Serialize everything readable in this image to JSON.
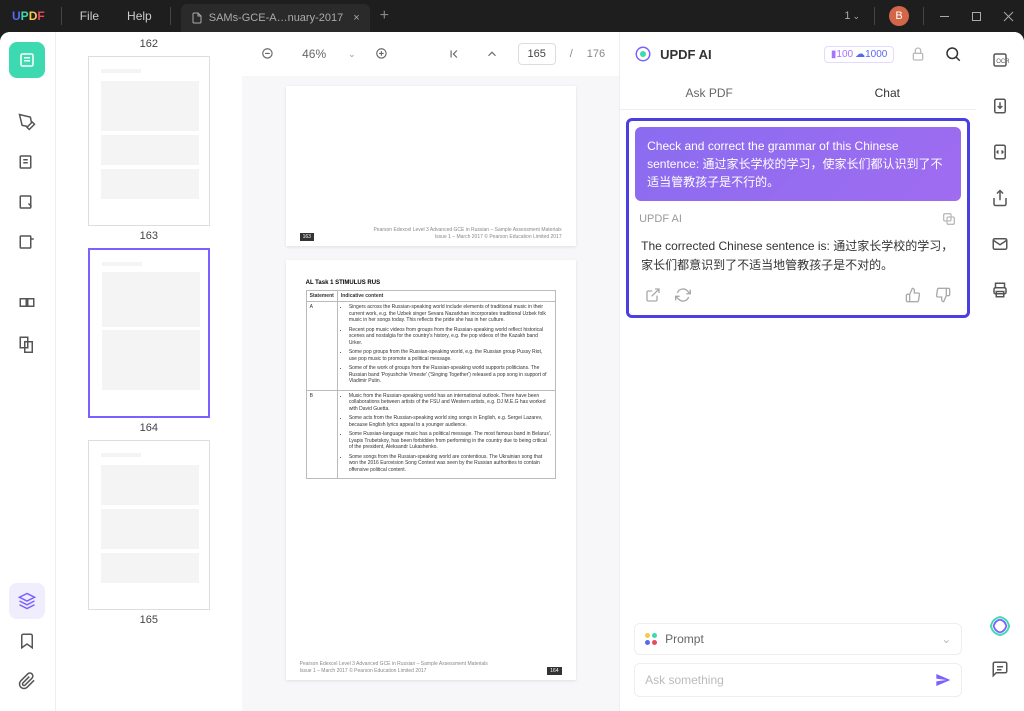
{
  "titlebar": {
    "menus": [
      "File",
      "Help"
    ],
    "tab_title": "SAMs-GCE-A…nuary-2017",
    "layout_label": "1",
    "avatar_initial": "B"
  },
  "thumbs": {
    "top_label": "162",
    "labels": [
      "163",
      "164",
      "165"
    ]
  },
  "toolbar": {
    "zoom": "46%",
    "page_current": "165",
    "page_total": "176"
  },
  "page_a": {
    "footer_line1": "Pearson Edexcel Level 3 Advanced GCE in Russian – Sample Assessment Materials",
    "footer_line2": "Issue 1 – March 2017 © Pearson Education Limited 2017",
    "badge": "163"
  },
  "page_b": {
    "task_title": "AL Task 1 STIMULUS RUS",
    "col_a": "Statement",
    "col_b": "Indicative content",
    "row_a_key": "A",
    "row_a_bullets": [
      "Singers across the Russian-speaking world include elements of traditional music in their current work, e.g. the Uzbek singer Sevara Nazarkhan incorporates traditional Uzbek folk music in her songs today. This reflects the pride she has in her culture.",
      "Recent pop music videos from groups from the Russian-speaking world reflect historical scenes and nostalgia for the country's history, e.g. the pop videos of the Kazakh band Urker.",
      "Some pop groups from the Russian-speaking world, e.g. the Russian group Pussy Riot, use pop music to promote a political message.",
      "Some of the work of groups from the Russian-speaking world supports politicians. The Russian band 'Poyushchie Vmeste' ('Singing Together') released a pop song in support of Vladimir Putin."
    ],
    "row_b_key": "B",
    "row_b_bullets": [
      "Music from the Russian-speaking world has an international outlook. There have been collaborations between artists of the FSU and Western artists, e.g. DJ M.E.G has worked with David Guetta.",
      "Some acts from the Russian-speaking world sing songs in English, e.g. Sergei Lazarev, because English lyrics appeal to a younger audience.",
      "Some Russian-language music has a political message. The most famous band in Belarus', Lyapis Trubetskoy, has been forbidden from performing in the country due to being critical of the president, Aleksandr Lukashenko.",
      "Some songs from the Russian-speaking world are contentious. The Ukrainian song that won the 2016 Eurovision Song Contest was seen by the Russian authorities to contain offensive political content."
    ],
    "footer_line1": "Pearson Edexcel Level 3 Advanced GCE in Russian – Sample Assessment Materials",
    "footer_line2": "Issue 1 – March 2017 © Pearson Education Limited 2017",
    "badge": "164"
  },
  "ai": {
    "title": "UPDF AI",
    "credit_a": "100",
    "credit_b": "1000",
    "tab_ask": "Ask PDF",
    "tab_chat": "Chat",
    "user_msg": "Check and correct the grammar of this Chinese sentence: 通过家长学校的学习，使家长们都认识到了不适当管教孩子是不行的。",
    "label": "UPDF AI",
    "ai_msg": "The corrected Chinese sentence is: 通过家长学校的学习，家长们都意识到了不适当地管教孩子是不对的。",
    "prompt_label": "Prompt",
    "placeholder": "Ask something"
  }
}
